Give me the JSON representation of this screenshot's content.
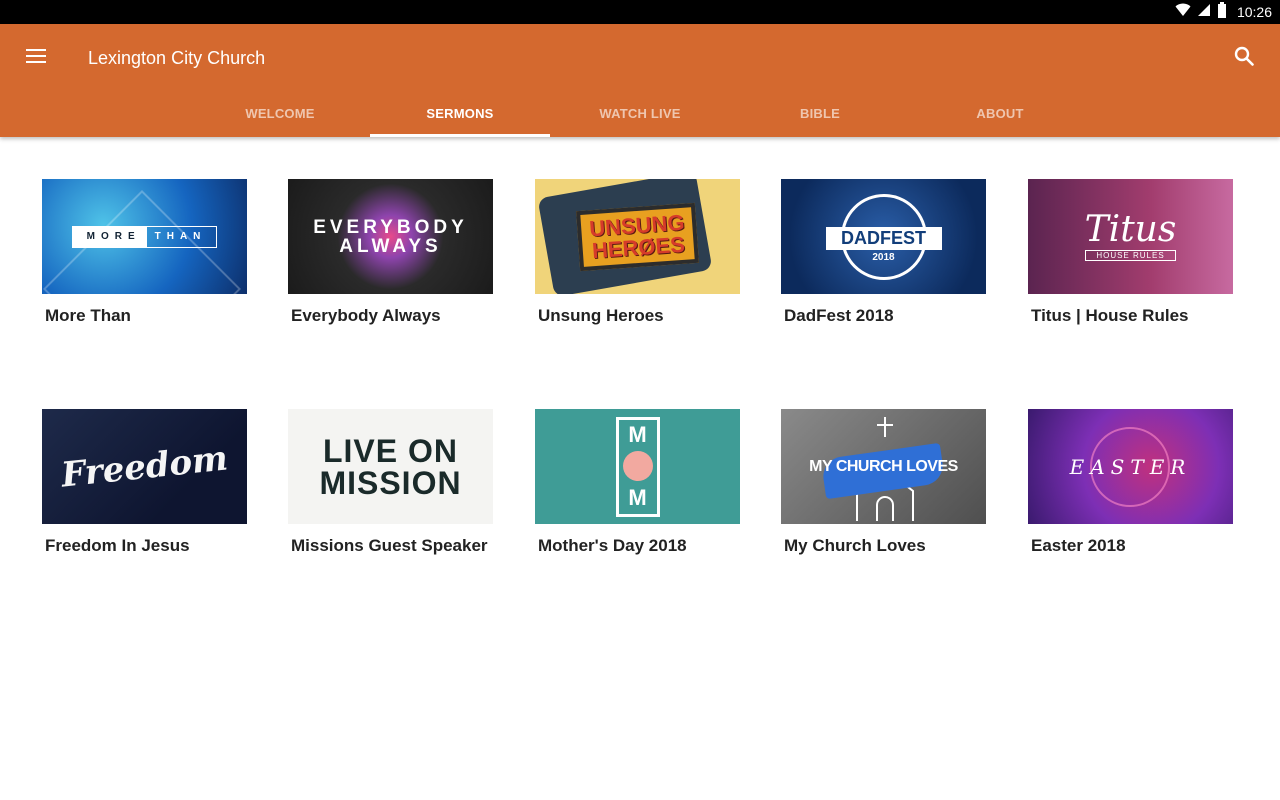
{
  "status_bar": {
    "time": "10:26"
  },
  "app_bar": {
    "title": "Lexington City Church",
    "tabs": [
      {
        "label": "WELCOME",
        "active": false
      },
      {
        "label": "SERMONS",
        "active": true
      },
      {
        "label": "WATCH LIVE",
        "active": false
      },
      {
        "label": "BIBLE",
        "active": false
      },
      {
        "label": "ABOUT",
        "active": false
      }
    ]
  },
  "colors": {
    "primary": "#d4692f",
    "status_bar": "#000000",
    "background": "#ffffff",
    "text": "#222222"
  },
  "sermons": [
    {
      "title": "More Than",
      "artwork": {
        "a": "MORE",
        "b": "THAN"
      }
    },
    {
      "title": "Everybody Always",
      "artwork": {
        "a": "EVERYBODY",
        "b": "ALWAYS"
      }
    },
    {
      "title": "Unsung Heroes",
      "artwork": {
        "a": "UNSUNG",
        "b": "HERØES"
      }
    },
    {
      "title": "DadFest 2018",
      "artwork": {
        "a": "DADFEST",
        "b": "2018"
      }
    },
    {
      "title": "Titus | House Rules",
      "artwork": {
        "a": "Titus",
        "b": "HOUSE RULES"
      }
    },
    {
      "title": "Freedom In Jesus",
      "artwork": {
        "a": "Freedom"
      }
    },
    {
      "title": "Missions Guest Speaker",
      "artwork": {
        "a": "LIVE ON",
        "b": "MISSION"
      }
    },
    {
      "title": "Mother's Day 2018",
      "artwork": {
        "a": "M",
        "b": "O",
        "c": "M"
      }
    },
    {
      "title": "My Church Loves",
      "artwork": {
        "a": "MY CHURCH LOVES"
      }
    },
    {
      "title": "Easter 2018",
      "artwork": {
        "a": "EASTER"
      }
    }
  ]
}
